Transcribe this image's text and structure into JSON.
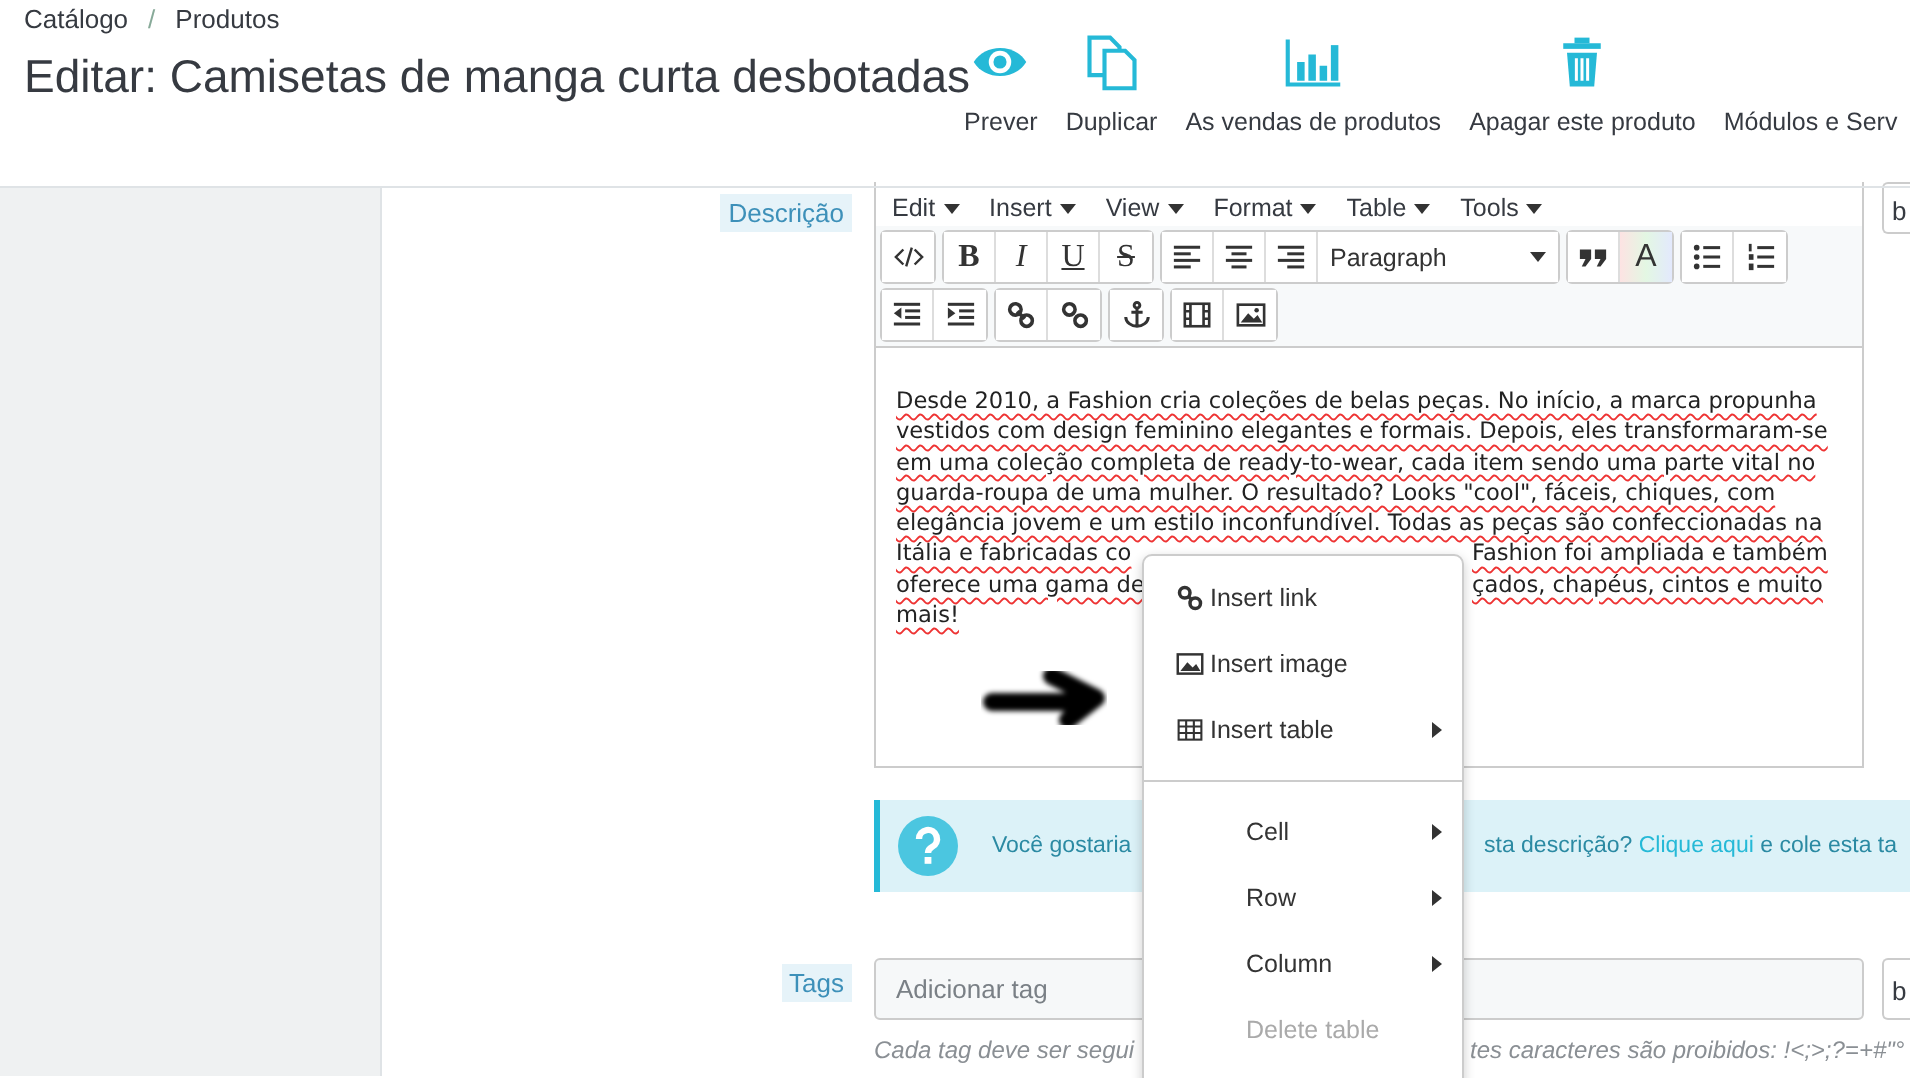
{
  "breadcrumb": {
    "items": [
      "Catálogo",
      "Produtos"
    ],
    "separator": "/"
  },
  "title": "Editar: Camisetas de manga curta desbotadas",
  "actions": [
    {
      "kind": "eye",
      "label": "Prever"
    },
    {
      "kind": "copy",
      "label": "Duplicar"
    },
    {
      "kind": "chart",
      "label": "As vendas de produtos"
    },
    {
      "kind": "trash",
      "label": "Apagar este produto"
    },
    {
      "kind": "none",
      "label": "Módulos e Serv"
    }
  ],
  "description": {
    "label": "Descrição",
    "menubar": [
      "Edit",
      "Insert",
      "View",
      "Format",
      "Table",
      "Tools"
    ],
    "toolbar_rows": [
      [
        [
          {
            "kind": "code"
          }
        ],
        [
          {
            "kind": "bold",
            "label": "B"
          },
          {
            "kind": "italic",
            "label": "I"
          },
          {
            "kind": "underline",
            "label": "U"
          },
          {
            "kind": "strike",
            "label": "S"
          }
        ],
        [
          {
            "kind": "align-left"
          },
          {
            "kind": "align-center"
          },
          {
            "kind": "align-right"
          },
          {
            "kind": "select",
            "label": "Paragraph"
          }
        ],
        [
          {
            "kind": "quote"
          },
          {
            "kind": "color",
            "label": "A"
          }
        ],
        [
          {
            "kind": "bullets"
          },
          {
            "kind": "numbers"
          }
        ]
      ],
      [
        [
          {
            "kind": "outdent"
          },
          {
            "kind": "indent"
          }
        ],
        [
          {
            "kind": "link"
          },
          {
            "kind": "unlink"
          }
        ],
        [
          {
            "kind": "anchor"
          }
        ],
        [
          {
            "kind": "film"
          },
          {
            "kind": "image"
          }
        ]
      ]
    ],
    "lines": [
      {
        "left": "Desde 2010, a Fashion cria coleções de belas peças. No início, a marca propunha"
      },
      {
        "left": "vestidos com design feminino elegantes e formais. Depois, eles transformaram-se"
      },
      {
        "left": "em uma coleção completa de ready-to-wear, cada item sendo uma parte vital no"
      },
      {
        "left": "guarda-roupa de uma mulher. O resultado? Looks \"cool\", fáceis, chiques, com"
      },
      {
        "left": "elegância jovem e um estilo inconfundível. Todas as peças são confeccionadas na"
      },
      {
        "left": "Itália e fabricadas co",
        "right": "Fashion foi ampliada e também"
      },
      {
        "left": "oferece uma gama de",
        "right": "çados, chapéus, cintos e muito"
      },
      {
        "left": "mais!"
      }
    ],
    "side_field": "b"
  },
  "info": {
    "left": "Você gostaria",
    "right": "sta descrição?",
    "link": "Clique aqui",
    "after": "e cole esta ta"
  },
  "tags": {
    "label": "Tags",
    "placeholder": "Adicionar tag",
    "side_field": "b",
    "hint_left": "Cada tag deve ser segui",
    "hint_right": "tes caracteres são proibidos: !<;>;?=+#\"°"
  },
  "context_menu": [
    [
      {
        "kind": "link",
        "label": "Insert link",
        "submenu": false,
        "disabled": false
      },
      {
        "kind": "image",
        "label": "Insert image",
        "submenu": false,
        "disabled": false
      },
      {
        "kind": "table",
        "label": "Insert table",
        "submenu": true,
        "disabled": false
      }
    ],
    [
      {
        "kind": "none",
        "label": "Cell",
        "submenu": true,
        "disabled": false
      },
      {
        "kind": "none",
        "label": "Row",
        "submenu": true,
        "disabled": false
      },
      {
        "kind": "none",
        "label": "Column",
        "submenu": true,
        "disabled": false
      },
      {
        "kind": "none",
        "label": "Delete table",
        "submenu": false,
        "disabled": true
      }
    ]
  ]
}
